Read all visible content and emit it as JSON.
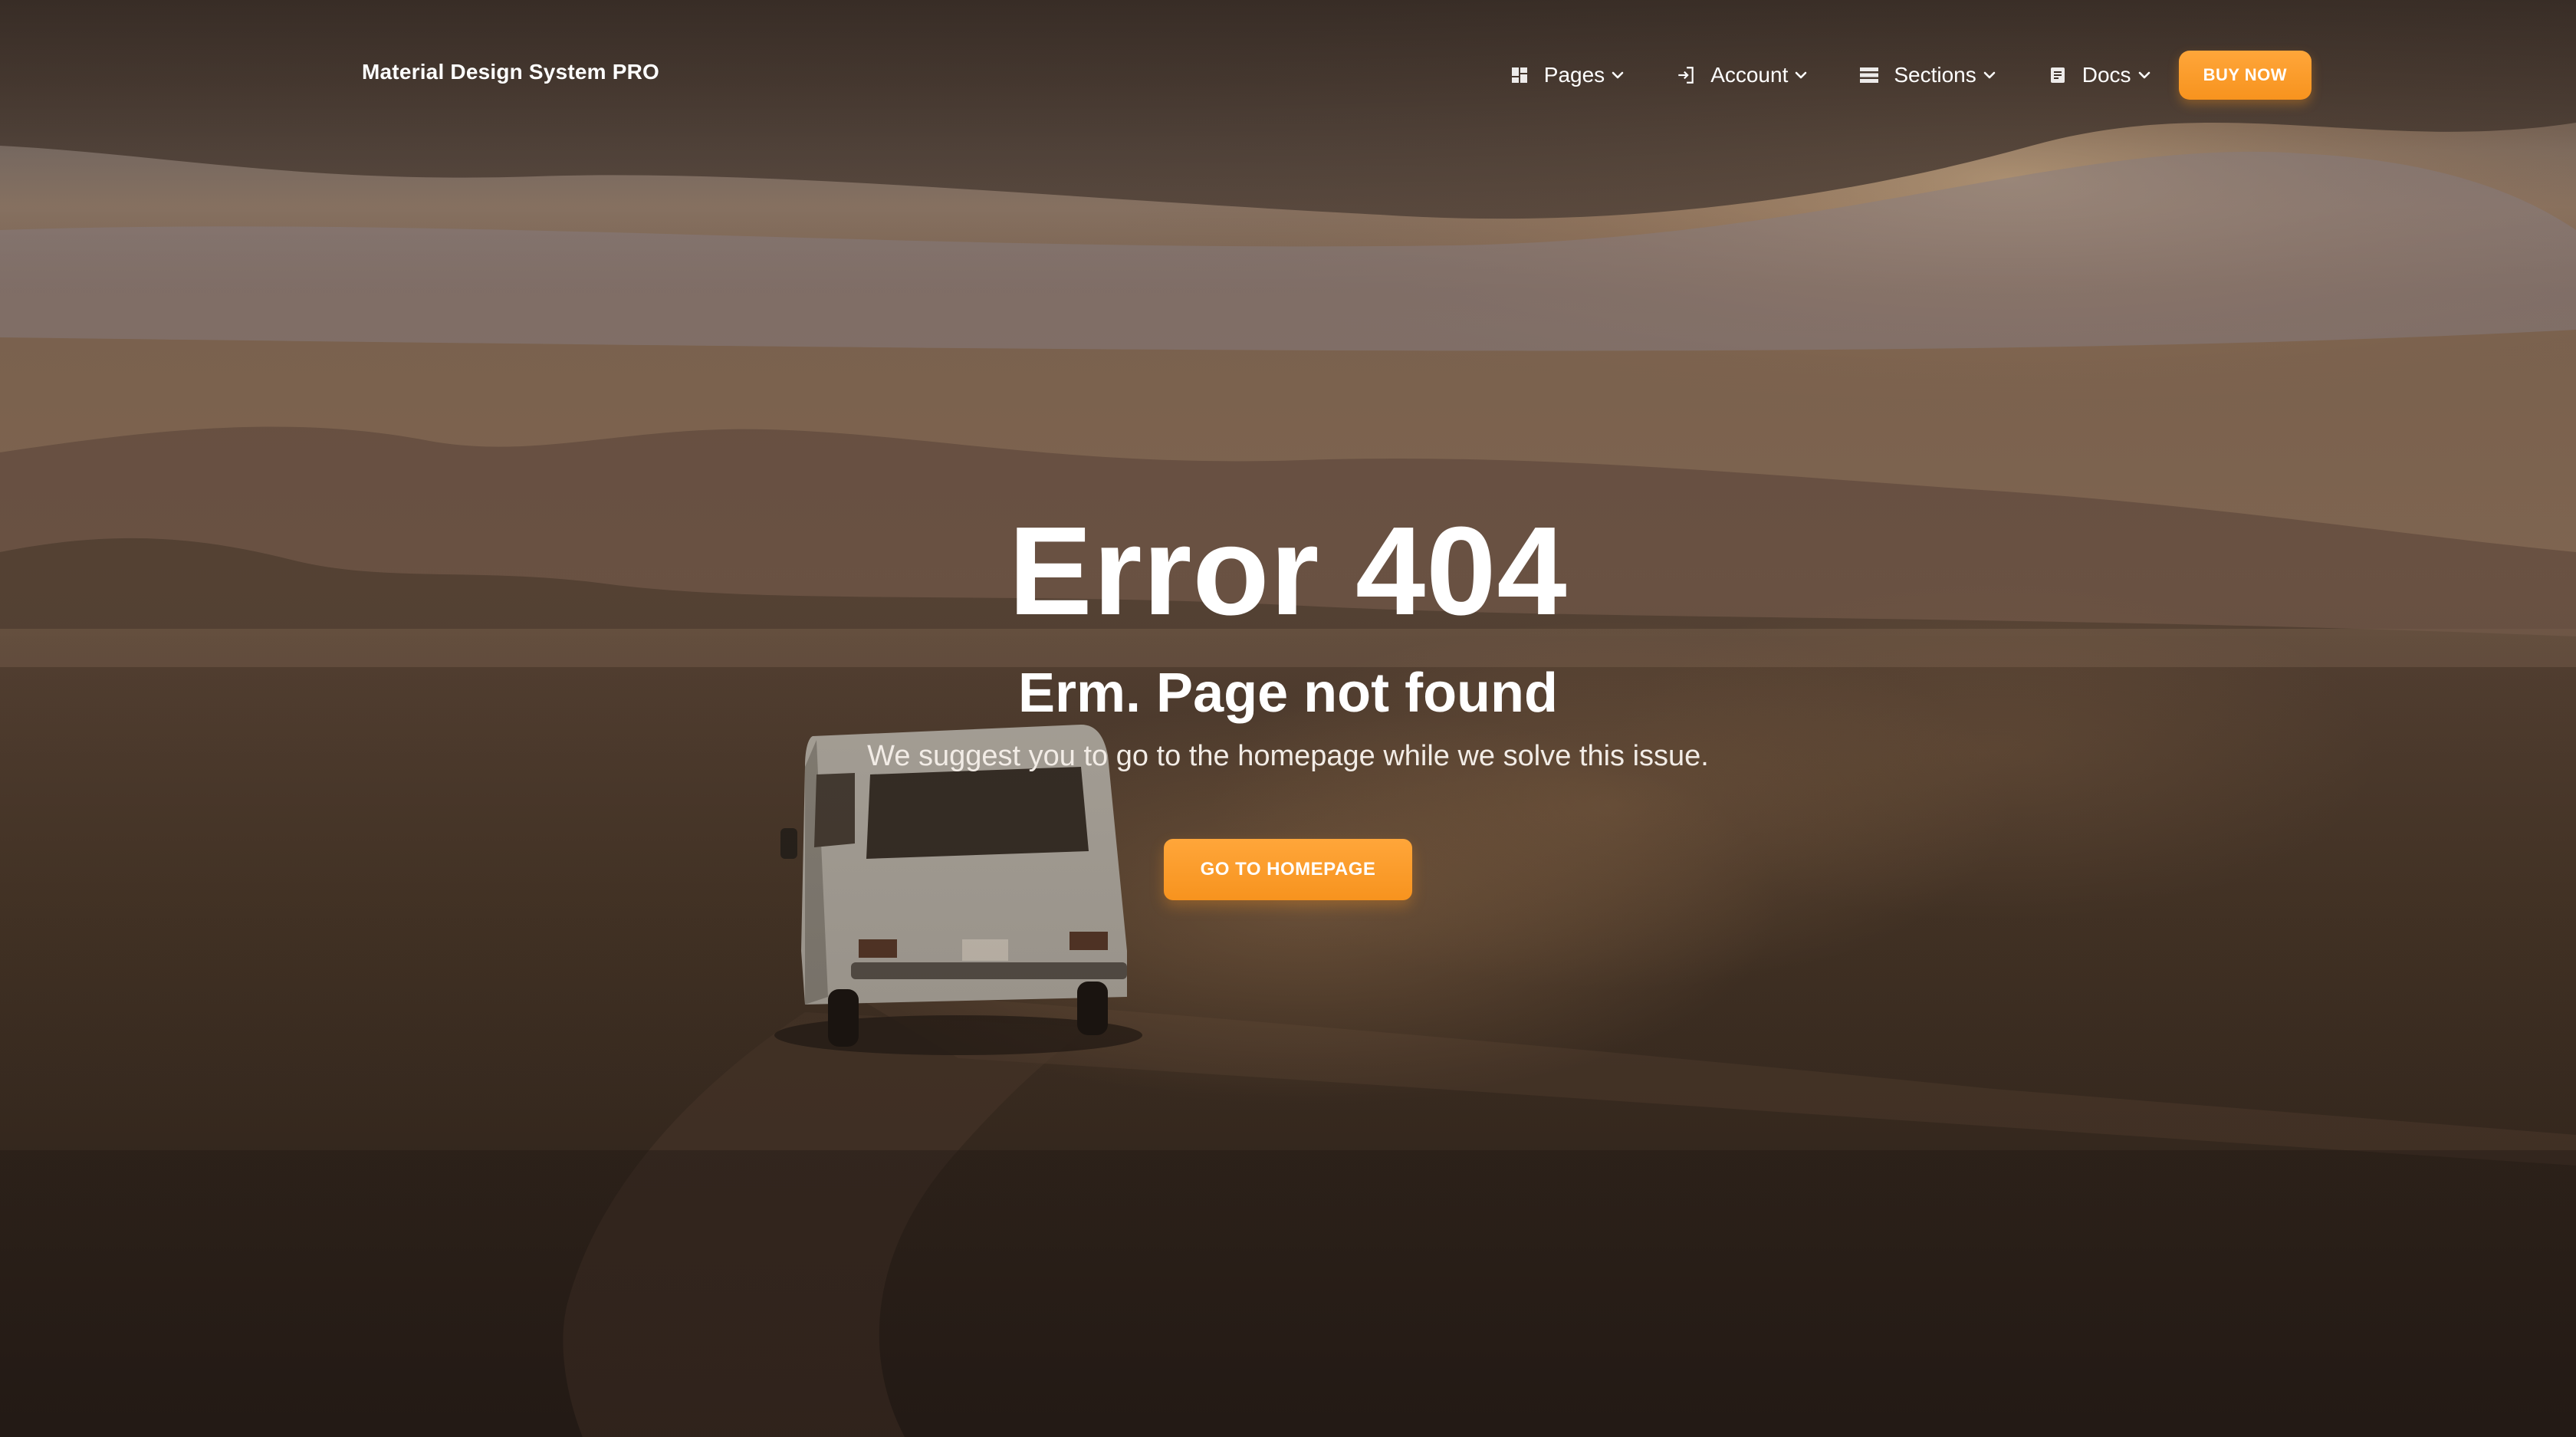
{
  "navbar": {
    "brand": "Material Design System PRO",
    "items": [
      {
        "label": "Pages",
        "icon": "dashboard-grid-icon"
      },
      {
        "label": "Account",
        "icon": "login-arrow-icon"
      },
      {
        "label": "Sections",
        "icon": "view-list-icon"
      },
      {
        "label": "Docs",
        "icon": "document-icon"
      }
    ],
    "buy_label": "BUY NOW"
  },
  "hero": {
    "title": "Error 404",
    "subtitle": "Erm. Page not found",
    "message": "We suggest you to go to the homepage while we solve this issue.",
    "button_label": "GO TO HOMEPAGE"
  },
  "colors": {
    "accent": "#f7931e",
    "text": "#ffffff"
  }
}
